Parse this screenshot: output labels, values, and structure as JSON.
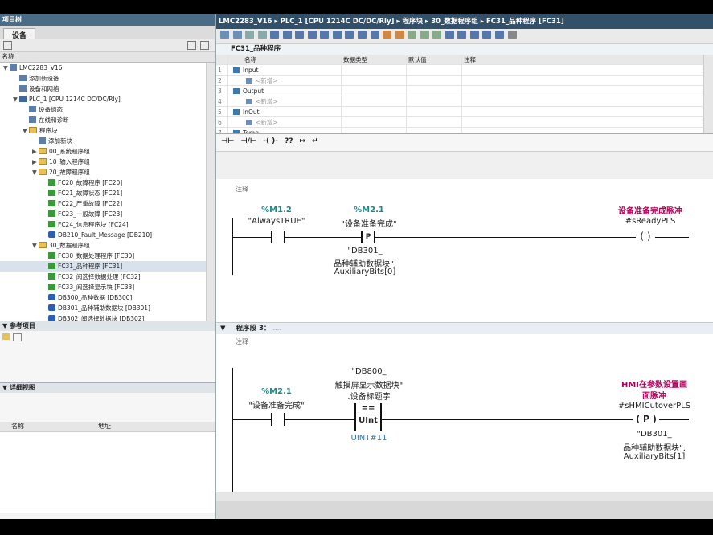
{
  "left": {
    "title": "项目树",
    "tab": "设备",
    "col_name": "名称",
    "tree": [
      {
        "label": "LMC2283_V16",
        "level": 0,
        "arrow": "▼",
        "icon": "doc"
      },
      {
        "label": "添加新设备",
        "level": 1,
        "arrow": "",
        "icon": "dev"
      },
      {
        "label": "设备和网络",
        "level": 1,
        "arrow": "",
        "icon": "dev"
      },
      {
        "label": "PLC_1 [CPU 1214C DC/DC/Rly]",
        "level": 1,
        "arrow": "▼",
        "icon": "plc"
      },
      {
        "label": "设备组态",
        "level": 2,
        "arrow": "",
        "icon": "dev"
      },
      {
        "label": "在线和诊断",
        "level": 2,
        "arrow": "",
        "icon": "dev"
      },
      {
        "label": "程序块",
        "level": 2,
        "arrow": "▼",
        "icon": "folder"
      },
      {
        "label": "添加新块",
        "level": 3,
        "arrow": "",
        "icon": "dev"
      },
      {
        "label": "00_系统程序组",
        "level": 3,
        "arrow": "▶",
        "icon": "folder"
      },
      {
        "label": "10_输入程序组",
        "level": 3,
        "arrow": "▶",
        "icon": "folder"
      },
      {
        "label": "20_故障程序组",
        "level": 3,
        "arrow": "▼",
        "icon": "folder"
      },
      {
        "label": "FC20_故障程序 [FC20]",
        "level": 4,
        "arrow": "",
        "icon": "green"
      },
      {
        "label": "FC21_故障状态 [FC21]",
        "level": 4,
        "arrow": "",
        "icon": "green"
      },
      {
        "label": "FC22_严重故障 [FC22]",
        "level": 4,
        "arrow": "",
        "icon": "green"
      },
      {
        "label": "FC23_一般故障 [FC23]",
        "level": 4,
        "arrow": "",
        "icon": "green"
      },
      {
        "label": "FC24_信息程序块 [FC24]",
        "level": 4,
        "arrow": "",
        "icon": "green"
      },
      {
        "label": "DB210_Fault_Message [DB210]",
        "level": 4,
        "arrow": "",
        "icon": "blue"
      },
      {
        "label": "30_数据程序组",
        "level": 3,
        "arrow": "▼",
        "icon": "folder"
      },
      {
        "label": "FC30_数据处理程序 [FC30]",
        "level": 4,
        "arrow": "",
        "icon": "green"
      },
      {
        "label": "FC31_品种程序 [FC31]",
        "level": 4,
        "arrow": "",
        "icon": "green",
        "selected": true
      },
      {
        "label": "FC32_阅选择数据处理 [FC32]",
        "level": 4,
        "arrow": "",
        "icon": "green"
      },
      {
        "label": "FC33_阅选择显示块 [FC33]",
        "level": 4,
        "arrow": "",
        "icon": "green"
      },
      {
        "label": "DB300_品种数据 [DB300]",
        "level": 4,
        "arrow": "",
        "icon": "blue"
      },
      {
        "label": "DB301_品种辅助数据块 [DB301]",
        "level": 4,
        "arrow": "",
        "icon": "blue"
      },
      {
        "label": "DB302_阅选择数据块 [DB302]",
        "level": 4,
        "arrow": "",
        "icon": "blue"
      }
    ],
    "ref_title": "参考项目",
    "detail_title": "详细视图",
    "detail_col_name": "名称",
    "detail_col_addr": "地址"
  },
  "right": {
    "breadcrumb": "LMC2283_V16 ▸ PLC_1 [CPU 1214C DC/DC/Rly] ▸ 程序块 ▸ 30_数据程序组 ▸ FC31_品种程序 [FC31]",
    "block_name": "FC31_品种程序",
    "iface_headers": [
      "名称",
      "数据类型",
      "默认值",
      "注释"
    ],
    "iface_rows": [
      {
        "num": "1",
        "name": "Input",
        "kind": "section"
      },
      {
        "num": "2",
        "name": "<新增>",
        "kind": "add"
      },
      {
        "num": "3",
        "name": "Output",
        "kind": "section"
      },
      {
        "num": "4",
        "name": "<新增>",
        "kind": "add"
      },
      {
        "num": "5",
        "name": "InOut",
        "kind": "section"
      },
      {
        "num": "6",
        "name": "<新增>",
        "kind": "add"
      },
      {
        "num": "7",
        "name": "Temp",
        "kind": "section"
      }
    ],
    "network2": {
      "comment": "注释",
      "c1_addr": "%M1.2",
      "c1_sym": "\"AlwaysTRUE\"",
      "c2_addr": "%M2.1",
      "c2_sym": "\"设备准备完成\"",
      "p_label": "P",
      "p_operand_1": "\"DB301_",
      "p_operand_2": "品种辅助数据块\".",
      "p_operand_3": "AuxiliaryBits[0]",
      "coil_name": "设备准备完成脉冲",
      "coil_sym": "#sReadyPLS"
    },
    "network3": {
      "title": "程序段 3：",
      "title_dots": "....",
      "comment": "注释",
      "c1_addr": "%M2.1",
      "c1_sym": "\"设备准备完成\"",
      "cmp_op1_1": "\"DB800_",
      "cmp_op1_2": "触摸屏显示数据块\"",
      "cmp_op1_3": ".设备标题字",
      "cmp_op": "==",
      "cmp_type": "UInt",
      "cmp_op2": "UINT#11",
      "coil_name_1": "HMI在参数设置画",
      "coil_name_2": "面脉冲",
      "coil_sym": "#sHMICutoverPLS",
      "coil_label": "P",
      "coil_operand_1": "\"DB301_",
      "coil_operand_2": "品种辅助数据块\".",
      "coil_operand_3": "AuxiliaryBits[1]"
    },
    "ladder_tools": [
      "⊣⊢",
      "⊣/⊢",
      "-( )-",
      "??",
      "↦",
      "↵"
    ]
  }
}
